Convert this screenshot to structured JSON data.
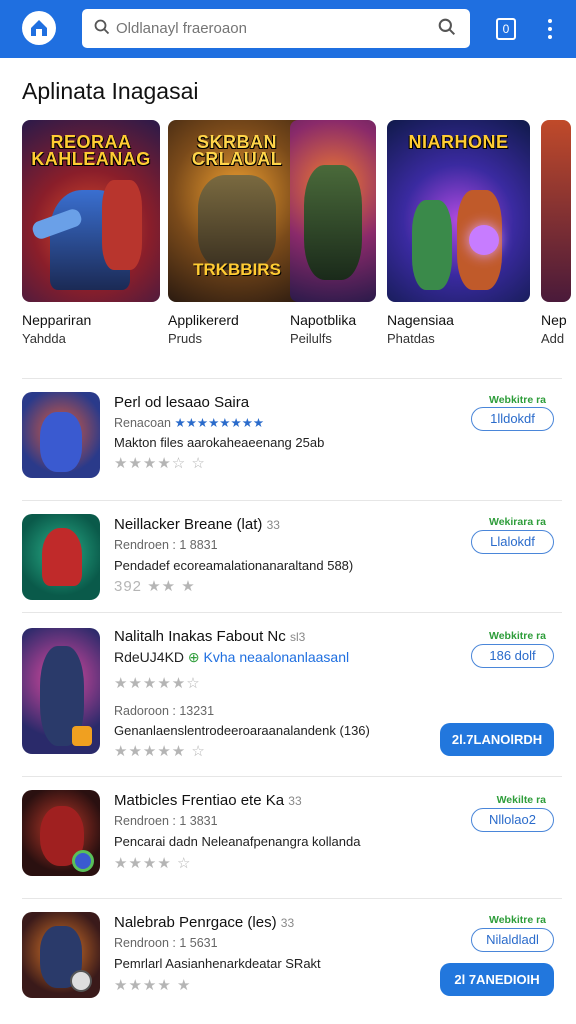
{
  "header": {
    "search_placeholder": "Oldlanayl fraeroaon",
    "tab_count": "0"
  },
  "section_title": "Aplinata Inagasai",
  "featured": [
    {
      "art_title": "REORAA KAHLEANAG",
      "name": "Neppariran",
      "sub": "Yahdda"
    },
    {
      "art_title": "SKRBAN CRLAUAL",
      "art_bottom": "TRKBBIRS",
      "name": "Applikererd",
      "sub": "Pruds"
    },
    {
      "art_title": "",
      "name": "Napotblika",
      "sub": "Peilulfs"
    },
    {
      "art_title": "NIARHONE",
      "name": "Nagensiaa",
      "sub": "Phatdas"
    },
    {
      "art_title": "",
      "name": "Nep",
      "sub": "Add"
    }
  ],
  "apps": [
    {
      "title": "Perl od lesaao Saira",
      "meta": "Renacoan",
      "rating_stars": "★★★★★★★★",
      "desc": "Makton files aarokaheaeenang 25ab",
      "stars": "★★★★☆ ☆",
      "tag": "Webkitre ra",
      "pill": "1lldokdf",
      "cta": ""
    },
    {
      "title": "Neillacker Breane (lat)",
      "title_suffix": "33",
      "meta": "Rendroen : 1 8831",
      "desc": "Pendadef ecoreamalationanaraltand 588)",
      "stars": "392 ★★ ★",
      "tag": "Wekirara ra",
      "pill": "Llalokdf",
      "cta": ""
    },
    {
      "title": "Nalitalh Inakas Fabout Nc",
      "title_suffix": "sl3",
      "sub_title": "RdeUJ4KD",
      "sub_highlight": "Kvha neaalonanlaasanl",
      "meta": "Radoroon : 13231",
      "desc": "Genanlaenslentrodeeroaraanalandenk (136)",
      "stars": "★★★★★ ☆",
      "gold_stars": "★★★★★☆",
      "tag": "Webkitre ra",
      "pill": "186 dolf",
      "cta": "2l.7LANOlRDH"
    },
    {
      "title": "Matbicles Frentiao ete Ka",
      "title_suffix": "33",
      "meta": "Rendroen : 1 3831",
      "desc": "Pencarai dadn Neleanafpenangra kollanda",
      "stars": "★★★★ ☆",
      "tag": "Wekilte ra",
      "pill": "Nllolao2",
      "cta": ""
    },
    {
      "title": "Nalebrab Penrgace (les)",
      "title_suffix": "33",
      "meta": "Rendroon : 1 5631",
      "desc": "Pemrlarl Aasianhenarkdeatar SRakt",
      "stars": "★★★★ ★",
      "tag": "Webkitre ra",
      "pill": "Nilaldladl",
      "cta": "2l 7ANEDIOIH"
    }
  ]
}
